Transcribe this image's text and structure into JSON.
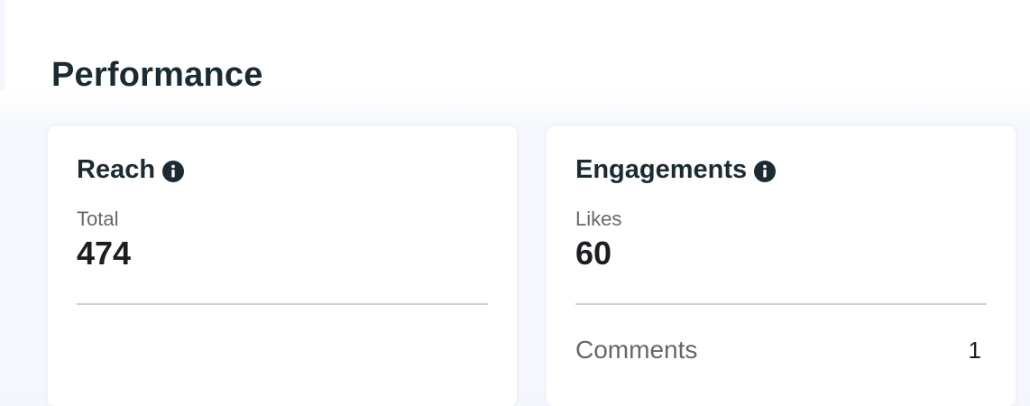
{
  "page": {
    "title": "Performance"
  },
  "reach": {
    "title": "Reach",
    "info_icon": "info-icon",
    "metric_label": "Total",
    "metric_value": "474"
  },
  "engagements": {
    "title": "Engagements",
    "info_icon": "info-icon",
    "metric_label": "Likes",
    "metric_value": "60",
    "rows": [
      {
        "label": "Comments",
        "value": "1"
      }
    ]
  },
  "colors": {
    "heading": "#1c2b33",
    "muted_text": "#65676b",
    "value_text": "#1c1e21",
    "divider": "#ced0d4",
    "background": "#f5f7fc",
    "card": "#ffffff"
  }
}
